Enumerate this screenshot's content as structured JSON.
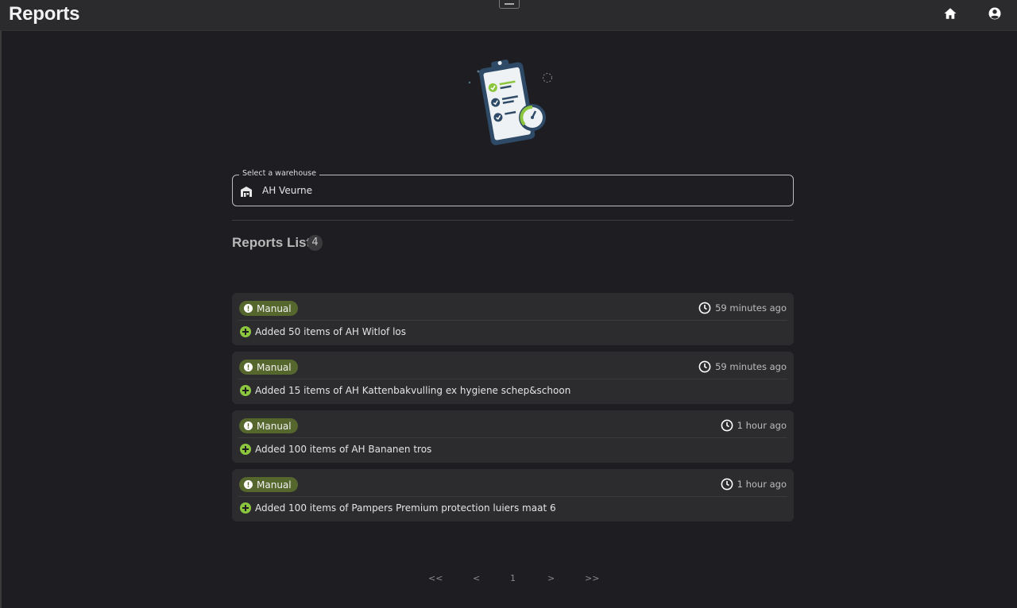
{
  "header": {
    "title": "Reports"
  },
  "warehouse_select": {
    "label": "Select a warehouse",
    "value": "AH Veurne"
  },
  "reports": {
    "title": "Reports List",
    "count": "4",
    "items": [
      {
        "type": "Manual",
        "time": "59 minutes ago",
        "description": "Added 50 items of AH Witlof los"
      },
      {
        "type": "Manual",
        "time": "59 minutes ago",
        "description": "Added 15 items of AH Kattenbakvulling ex hygiene schep&schoon"
      },
      {
        "type": "Manual",
        "time": "1 hour ago",
        "description": "Added 100 items of AH Bananen tros"
      },
      {
        "type": "Manual",
        "time": "1 hour ago",
        "description": "Added 100 items of Pampers Premium protection luiers maat 6"
      }
    ]
  },
  "pagination": {
    "first": "<<",
    "prev": "<",
    "page": "1",
    "next": ">",
    "last": ">>"
  },
  "icons": {
    "home": "home-icon",
    "account": "account-icon",
    "warehouse": "warehouse-icon",
    "badge": "exclamation-icon",
    "time": "clock-icon",
    "add": "plus-icon"
  },
  "colors": {
    "accent": "#8cc63f",
    "badge": "#56672e",
    "background": "#1e1d21",
    "card": "#2c2b2e"
  }
}
